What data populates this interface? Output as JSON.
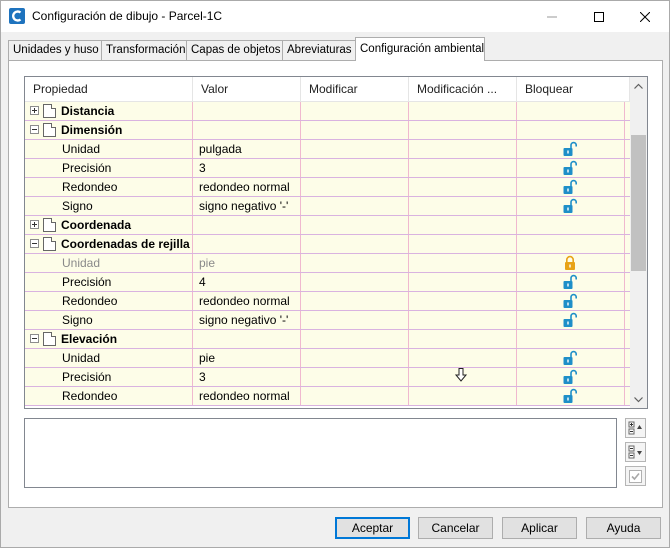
{
  "window": {
    "title": "Configuración de dibujo - Parcel-1C",
    "controls": {
      "minimize": "minimize-icon",
      "maximize": "maximize-icon",
      "close": "close-icon"
    }
  },
  "tabs": [
    {
      "label": "Unidades y huso"
    },
    {
      "label": "Transformación"
    },
    {
      "label": "Capas de objetos"
    },
    {
      "label": "Abreviaturas"
    },
    {
      "label": "Configuración ambiental",
      "active": true
    }
  ],
  "grid": {
    "columns": [
      "Propiedad",
      "Valor",
      "Modificar",
      "Modificación ...",
      "Bloquear"
    ],
    "rows": [
      {
        "type": "group",
        "label": "Distancia",
        "expanded": false
      },
      {
        "type": "group",
        "label": "Dimensión",
        "expanded": true
      },
      {
        "type": "prop",
        "label": "Unidad",
        "value": "pulgada",
        "lock": "unlocked"
      },
      {
        "type": "prop",
        "label": "Precisión",
        "value": "3",
        "lock": "unlocked"
      },
      {
        "type": "prop",
        "label": "Redondeo",
        "value": "redondeo normal",
        "lock": "unlocked"
      },
      {
        "type": "prop",
        "label": "Signo",
        "value": "signo negativo '-'",
        "lock": "unlocked"
      },
      {
        "type": "group",
        "label": "Coordenada",
        "expanded": false
      },
      {
        "type": "group",
        "label": "Coordenadas de rejilla",
        "expanded": true
      },
      {
        "type": "prop",
        "label": "Unidad",
        "value": "pie",
        "lock": "locked",
        "disabled": true
      },
      {
        "type": "prop",
        "label": "Precisión",
        "value": "4",
        "lock": "unlocked"
      },
      {
        "type": "prop",
        "label": "Redondeo",
        "value": "redondeo normal",
        "lock": "unlocked"
      },
      {
        "type": "prop",
        "label": "Signo",
        "value": "signo negativo '-'",
        "lock": "unlocked"
      },
      {
        "type": "group",
        "label": "Elevación",
        "expanded": true
      },
      {
        "type": "prop",
        "label": "Unidad",
        "value": "pie",
        "lock": "unlocked"
      },
      {
        "type": "prop",
        "label": "Precisión",
        "value": "3",
        "lock": "unlocked"
      },
      {
        "type": "prop",
        "label": "Redondeo",
        "value": "redondeo normal",
        "lock": "unlocked"
      }
    ]
  },
  "buttons": {
    "accept": "Aceptar",
    "cancel": "Cancelar",
    "apply": "Aplicar",
    "help": "Ayuda"
  },
  "colors": {
    "row_bg": "#fdfde8",
    "lock_unlocked": "#1e8fc8",
    "lock_locked": "#e8a317",
    "default_button_border": "#0078d7"
  }
}
